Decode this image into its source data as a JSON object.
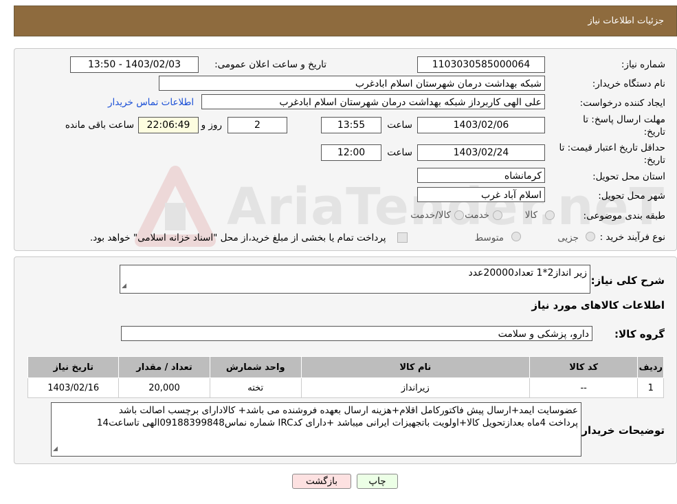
{
  "header": {
    "title": "جزئیات اطلاعات نیاز"
  },
  "form": {
    "need_number_label": "شماره نیاز:",
    "need_number": "1103030585000064",
    "announce_label": "تاریخ و ساعت اعلان عمومی:",
    "announce_value": "1403/02/03 - 13:50",
    "buyer_org_label": "نام دستگاه خریدار:",
    "buyer_org": "شبکه بهداشت درمان شهرستان اسلام ابادغرب",
    "creator_label": "ایجاد کننده درخواست:",
    "creator": "علی الهی کاربرداز شبکه بهداشت درمان شهرستان اسلام ابادغرب",
    "contact_link": "اطلاعات تماس خریدار",
    "deadline_label_1": "مهلت ارسال پاسخ: تا",
    "deadline_label_2": "تاریخ:",
    "deadline_date": "1403/02/06",
    "time_label": "ساعت",
    "deadline_time": "13:55",
    "days_value": "2",
    "days_label": "روز و",
    "remaining_time": "22:06:49",
    "remaining_label": "ساعت باقی مانده",
    "validity_label_1": "حداقل تاریخ اعتبار قیمت: تا",
    "validity_label_2": "تاریخ:",
    "validity_date": "1403/02/24",
    "validity_time": "12:00",
    "province_label": "استان محل تحویل:",
    "province": "کرمانشاه",
    "city_label": "شهر محل تحویل:",
    "city": "اسلام آباد غرب",
    "category_label": "طبقه بندی موضوعی:",
    "category_options": [
      "کالا",
      "خدمت",
      "کالا/خدمت"
    ],
    "process_label": "نوع فرآیند خرید :",
    "process_options": [
      "جزیی",
      "متوسط"
    ],
    "process_note": "پرداخت تمام یا بخشی از مبلغ خرید،از محل \"اسناد خزانه اسلامی\" خواهد بود."
  },
  "summary": {
    "description_label": "شرح کلی نیاز:",
    "description": "زیر انداز2*1 تعداد20000عدد",
    "goods_info_title": "اطلاعات کالاهای مورد نیاز",
    "goods_group_label": "گروه کالا:",
    "goods_group": "دارو، پزشکی و سلامت"
  },
  "table": {
    "headers": [
      "ردیف",
      "کد کالا",
      "نام کالا",
      "واحد شمارش",
      "تعداد / مقدار",
      "تاریخ نیاز"
    ],
    "rows": [
      [
        "1",
        "--",
        "زیرانداز",
        "تخته",
        "20,000",
        "1403/02/16"
      ]
    ]
  },
  "buyer_notes": {
    "label": "توضیحات خریدار:",
    "line1": "عضوسایت ایمد+ارسال پیش فاکتورکامل اقلام+هزینه ارسال بعهده فروشنده می باشد+ کالادارای برچسب اصالت باشد",
    "line2": "پرداخت 4ماه بعدازتحویل کالا+اولویت باتجهیزات ایرانی میباشد +دارای کدIRC شماره نماس09188399848الهی تاساعت14"
  },
  "buttons": {
    "print": "چاپ",
    "back": "بازگشت"
  },
  "watermark": {
    "text": "AriaTender.neT"
  },
  "colors": {
    "header_bg": "#8e6b3e",
    "link": "#1a4fd6",
    "back_button_bg": "#fde1e1",
    "print_button_bg": "#ecffe6"
  }
}
